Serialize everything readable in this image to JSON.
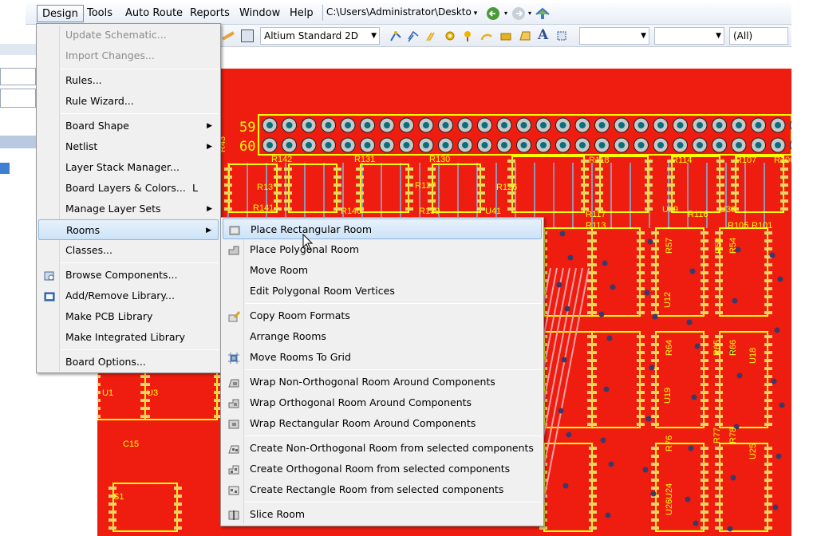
{
  "menubar": {
    "items": [
      "Design",
      "Tools",
      "Auto Route",
      "Reports",
      "Window",
      "Help"
    ],
    "path": "C:\\Users\\Administrator\\Deskto"
  },
  "toolbar": {
    "view_mode": "Altium Standard 2D",
    "combo2": "",
    "combo3": "",
    "filter": "(All)"
  },
  "design_menu": {
    "items": [
      {
        "label": "Update Schematic...",
        "disabled": true
      },
      {
        "label": "Import Changes...",
        "disabled": true
      },
      {
        "label": "Rules..."
      },
      {
        "label": "Rule Wizard..."
      },
      {
        "label": "Board Shape",
        "submenu": true
      },
      {
        "label": "Netlist",
        "submenu": true
      },
      {
        "label": "Layer Stack Manager..."
      },
      {
        "label": "Board Layers & Colors...",
        "shortcut": "L"
      },
      {
        "label": "Manage Layer Sets",
        "submenu": true
      },
      {
        "label": "Rooms",
        "submenu": true,
        "highlighted": true
      },
      {
        "label": "Classes..."
      },
      {
        "label": "Browse Components...",
        "icon": "browse-components-icon"
      },
      {
        "label": "Add/Remove Library...",
        "icon": "library-book-icon"
      },
      {
        "label": "Make PCB Library"
      },
      {
        "label": "Make Integrated Library"
      },
      {
        "label": "Board Options..."
      }
    ]
  },
  "rooms_menu": {
    "items": [
      {
        "label": "Place Rectangular Room",
        "icon": "rectangular-room-icon",
        "highlighted": true
      },
      {
        "label": "Place Polygonal Room",
        "icon": "polygonal-room-icon"
      },
      {
        "label": "Move Room"
      },
      {
        "label": "Edit Polygonal Room Vertices"
      },
      {
        "label": "Copy Room Formats",
        "icon": "copy-format-brush-icon"
      },
      {
        "label": "Arrange Rooms"
      },
      {
        "label": "Move Rooms To Grid",
        "icon": "grid-move-icon"
      },
      {
        "label": "Wrap Non-Orthogonal Room Around Components",
        "icon": "wrap-nonortho-icon"
      },
      {
        "label": "Wrap Orthogonal Room Around Components",
        "icon": "wrap-ortho-icon"
      },
      {
        "label": "Wrap Rectangular Room Around Components",
        "icon": "wrap-rect-icon"
      },
      {
        "label": "Create Non-Orthogonal Room from selected components",
        "icon": "create-nonortho-icon"
      },
      {
        "label": "Create Orthogonal Room from selected components",
        "icon": "create-ortho-icon"
      },
      {
        "label": "Create Rectangle Room from selected components",
        "icon": "create-rect-icon"
      },
      {
        "label": "Slice Room",
        "icon": "slice-room-icon"
      }
    ]
  },
  "pcb": {
    "header_numbers": [
      "59",
      "60"
    ],
    "designators": [
      "R142",
      "R131",
      "R130",
      "R118",
      "R114",
      "R107",
      "R106",
      "R141",
      "R140",
      "R139",
      "R117",
      "R113",
      "R116",
      "R105",
      "R101",
      "R13",
      "R127",
      "R126",
      "U41",
      "U39",
      "U36",
      "U3",
      "U1",
      "C15",
      "S1",
      "U12",
      "U19",
      "U24",
      "U26",
      "U18",
      "U25",
      "R57",
      "R53",
      "R54",
      "R64",
      "R65",
      "R66",
      "R76",
      "R77",
      "R78",
      "R43"
    ],
    "colors": {
      "board": "#ef1c10",
      "silk": "#ffff00",
      "pad": "#c8c8c8",
      "via": "#0a6e7c",
      "trace": "#7fb3d8"
    }
  }
}
